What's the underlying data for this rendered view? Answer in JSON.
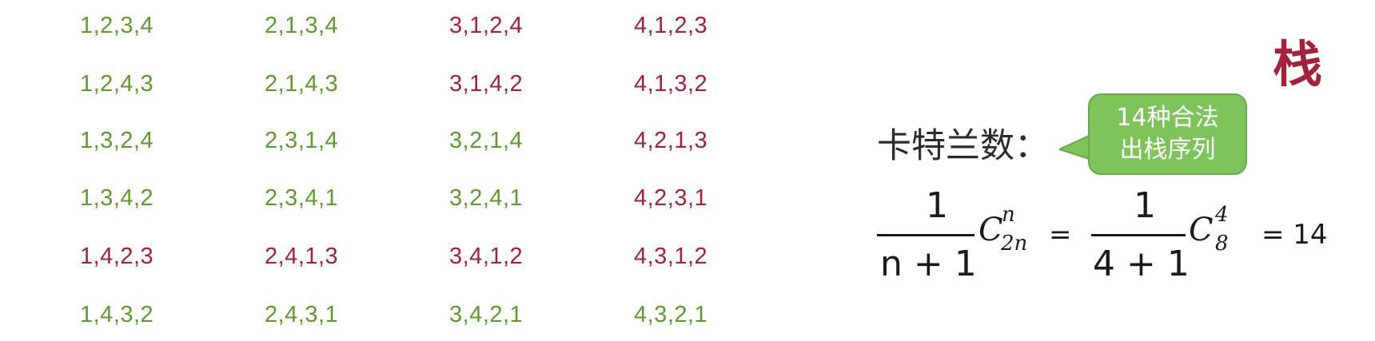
{
  "title": "栈",
  "sequences": [
    [
      {
        "text": "1,2,3,4",
        "valid": true
      },
      {
        "text": "2,1,3,4",
        "valid": true
      },
      {
        "text": "3,1,2,4",
        "valid": false
      },
      {
        "text": "4,1,2,3",
        "valid": false
      }
    ],
    [
      {
        "text": "1,2,4,3",
        "valid": true
      },
      {
        "text": "2,1,4,3",
        "valid": true
      },
      {
        "text": "3,1,4,2",
        "valid": false
      },
      {
        "text": "4,1,3,2",
        "valid": false
      }
    ],
    [
      {
        "text": "1,3,2,4",
        "valid": true
      },
      {
        "text": "2,3,1,4",
        "valid": true
      },
      {
        "text": "3,2,1,4",
        "valid": true
      },
      {
        "text": "4,2,1,3",
        "valid": false
      }
    ],
    [
      {
        "text": "1,3,4,2",
        "valid": true
      },
      {
        "text": "2,3,4,1",
        "valid": true
      },
      {
        "text": "3,2,4,1",
        "valid": true
      },
      {
        "text": "4,2,3,1",
        "valid": false
      }
    ],
    [
      {
        "text": "1,4,2,3",
        "valid": false
      },
      {
        "text": "2,4,1,3",
        "valid": false
      },
      {
        "text": "3,4,1,2",
        "valid": false
      },
      {
        "text": "4,3,1,2",
        "valid": false
      }
    ],
    [
      {
        "text": "1,4,3,2",
        "valid": true
      },
      {
        "text": "2,4,3,1",
        "valid": true
      },
      {
        "text": "3,4,2,1",
        "valid": true
      },
      {
        "text": "4,3,2,1",
        "valid": true
      }
    ]
  ],
  "colors": {
    "valid": "#5f9a2e",
    "invalid": "#a4213c",
    "bubble": "#7ec45a"
  },
  "catalan": {
    "label": "卡特兰数：",
    "bubble_line1": "14种合法",
    "bubble_line2": "出栈序列",
    "formula": {
      "one": "1",
      "denominator": "n + 1",
      "C": "C",
      "sub": "2n",
      "sup": "n",
      "eq1": "=",
      "one2": "1",
      "denominator2": "4 + 1",
      "C2": "C",
      "sub2": "8",
      "sup2": "4",
      "result": "= 14"
    }
  }
}
